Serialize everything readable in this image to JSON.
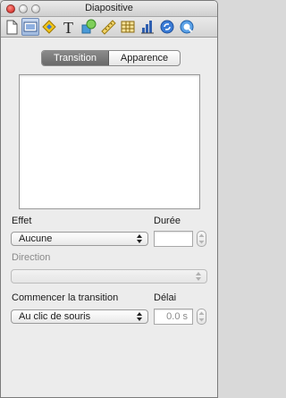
{
  "window": {
    "title": "Diapositive"
  },
  "toolbar": {
    "items": [
      {
        "icon": "document-icon"
      },
      {
        "icon": "slide-icon",
        "selected": true
      },
      {
        "icon": "build-icon"
      },
      {
        "icon": "text-icon",
        "glyph": "T"
      },
      {
        "icon": "graphic-icon"
      },
      {
        "icon": "metrics-icon"
      },
      {
        "icon": "table-icon"
      },
      {
        "icon": "chart-icon"
      },
      {
        "icon": "hyperlink-icon"
      },
      {
        "icon": "quicktime-icon"
      }
    ]
  },
  "tabs": {
    "active": "Transition",
    "inactive": "Apparence"
  },
  "effect": {
    "label": "Effet",
    "value": "Aucune"
  },
  "duration": {
    "label": "Durée",
    "value": ""
  },
  "direction": {
    "label": "Direction",
    "value": ""
  },
  "start": {
    "label": "Commencer la transition",
    "value": "Au clic de souris"
  },
  "delay": {
    "label": "Délai",
    "value": "0.0 s"
  }
}
